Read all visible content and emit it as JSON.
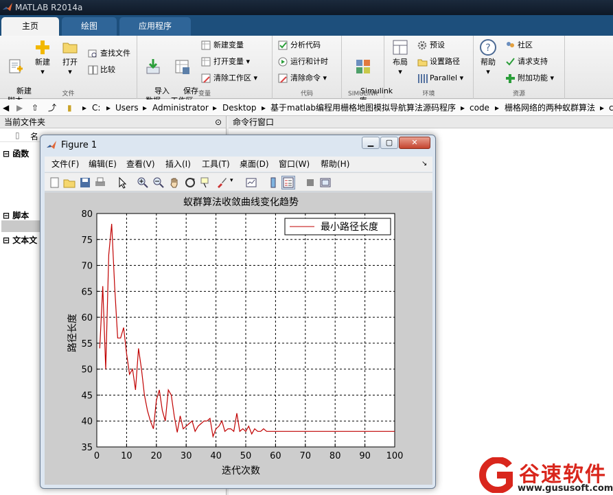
{
  "app": {
    "title": "MATLAB R2014a"
  },
  "tabs": [
    {
      "label": "主页"
    },
    {
      "label": "绘图"
    },
    {
      "label": "应用程序"
    }
  ],
  "ribbon": {
    "file": {
      "group_label": "文件",
      "new_script": "新建\n脚本",
      "new": "新建",
      "open": "打开",
      "find_files": "查找文件",
      "compare": "比较"
    },
    "variable": {
      "group_label": "变量",
      "import": "导入\n数据",
      "save_ws": "保存\n工作区",
      "new_var": "新建变量",
      "open_var": "打开变量",
      "clear_ws": "清除工作区"
    },
    "code": {
      "group_label": "代码",
      "analyze": "分析代码",
      "run_time": "运行和计时",
      "clear_cmd": "清除命令"
    },
    "simulink": {
      "group_label": "SIMULINK",
      "lib": "Simulink\n库"
    },
    "env": {
      "group_label": "环境",
      "layout": "布局",
      "prefs": "预设",
      "set_path": "设置路径",
      "parallel": "Parallel"
    },
    "resources": {
      "group_label": "资源",
      "help": "帮助",
      "community": "社区",
      "support": "请求支持",
      "addons": "附加功能"
    }
  },
  "address": {
    "segments": [
      "C:",
      "Users",
      "Administrator",
      "Desktop",
      "基于matlab编程用栅格地图模拟导航算法源码程序",
      "code",
      "栅格网络的两种蚁群算法",
      "c"
    ]
  },
  "left_panel": {
    "title": "当前文件夹",
    "name_col": "名",
    "sections": [
      "函数",
      "脚本",
      "文本文"
    ]
  },
  "right_panel": {
    "title": "命令行窗口"
  },
  "figure": {
    "title": "Figure 1",
    "menu": [
      "文件(F)",
      "编辑(E)",
      "查看(V)",
      "插入(I)",
      "工具(T)",
      "桌面(D)",
      "窗口(W)",
      "帮助(H)"
    ]
  },
  "chart_data": {
    "type": "line",
    "title": "蚁群算法收敛曲线变化趋势",
    "xlabel": "迭代次数",
    "ylabel": "路径长度",
    "xlim": [
      0,
      100
    ],
    "ylim": [
      35,
      80
    ],
    "xticks": [
      0,
      10,
      20,
      30,
      40,
      50,
      60,
      70,
      80,
      90,
      100
    ],
    "yticks": [
      35,
      40,
      45,
      50,
      55,
      60,
      65,
      70,
      75,
      80
    ],
    "grid": true,
    "legend_position": "top-right",
    "series": [
      {
        "name": "最小路径长度",
        "color": "#c00000",
        "x": [
          1,
          2,
          3,
          4,
          5,
          6,
          7,
          8,
          9,
          10,
          11,
          12,
          13,
          14,
          15,
          16,
          17,
          18,
          19,
          20,
          21,
          22,
          23,
          24,
          25,
          26,
          27,
          28,
          29,
          30,
          31,
          32,
          33,
          34,
          35,
          36,
          37,
          38,
          39,
          40,
          41,
          42,
          43,
          44,
          45,
          46,
          47,
          48,
          49,
          50,
          51,
          52,
          53,
          54,
          55,
          56,
          57,
          58,
          59,
          60,
          61,
          62,
          63,
          64,
          65,
          66,
          67,
          68,
          69,
          70,
          71,
          72,
          73,
          74,
          75,
          76,
          77,
          78,
          79,
          80,
          81,
          82,
          83,
          84,
          85,
          86,
          87,
          88,
          89,
          90,
          91,
          92,
          93,
          94,
          95,
          96,
          97,
          98,
          99,
          100
        ],
        "y": [
          54,
          66,
          50,
          72,
          78,
          66,
          56,
          56,
          58,
          53,
          49,
          50,
          46,
          54,
          50,
          45,
          42,
          40,
          38.5,
          44,
          46,
          42,
          40,
          46,
          45,
          41,
          37.8,
          41,
          38.5,
          39,
          39.5,
          40,
          38,
          39,
          39.5,
          40,
          40,
          40.5,
          37,
          38.5,
          39,
          40,
          38,
          38.5,
          38.5,
          38,
          41.5,
          38,
          38.5,
          38,
          39,
          37.5,
          38.5,
          38,
          38,
          38.5,
          38,
          38,
          38,
          38,
          38,
          38,
          38,
          38,
          38,
          38,
          38,
          38,
          38,
          38,
          38,
          38,
          38,
          38,
          38,
          38,
          38,
          38,
          38,
          38,
          38,
          38,
          38,
          38,
          38,
          38,
          38,
          38,
          38,
          38,
          38,
          38,
          38,
          38,
          38,
          38,
          38,
          38,
          38,
          38
        ]
      }
    ]
  },
  "watermark": {
    "brand": "谷速软件",
    "url": "www.gususoft.com",
    "color": "#d9261c"
  }
}
